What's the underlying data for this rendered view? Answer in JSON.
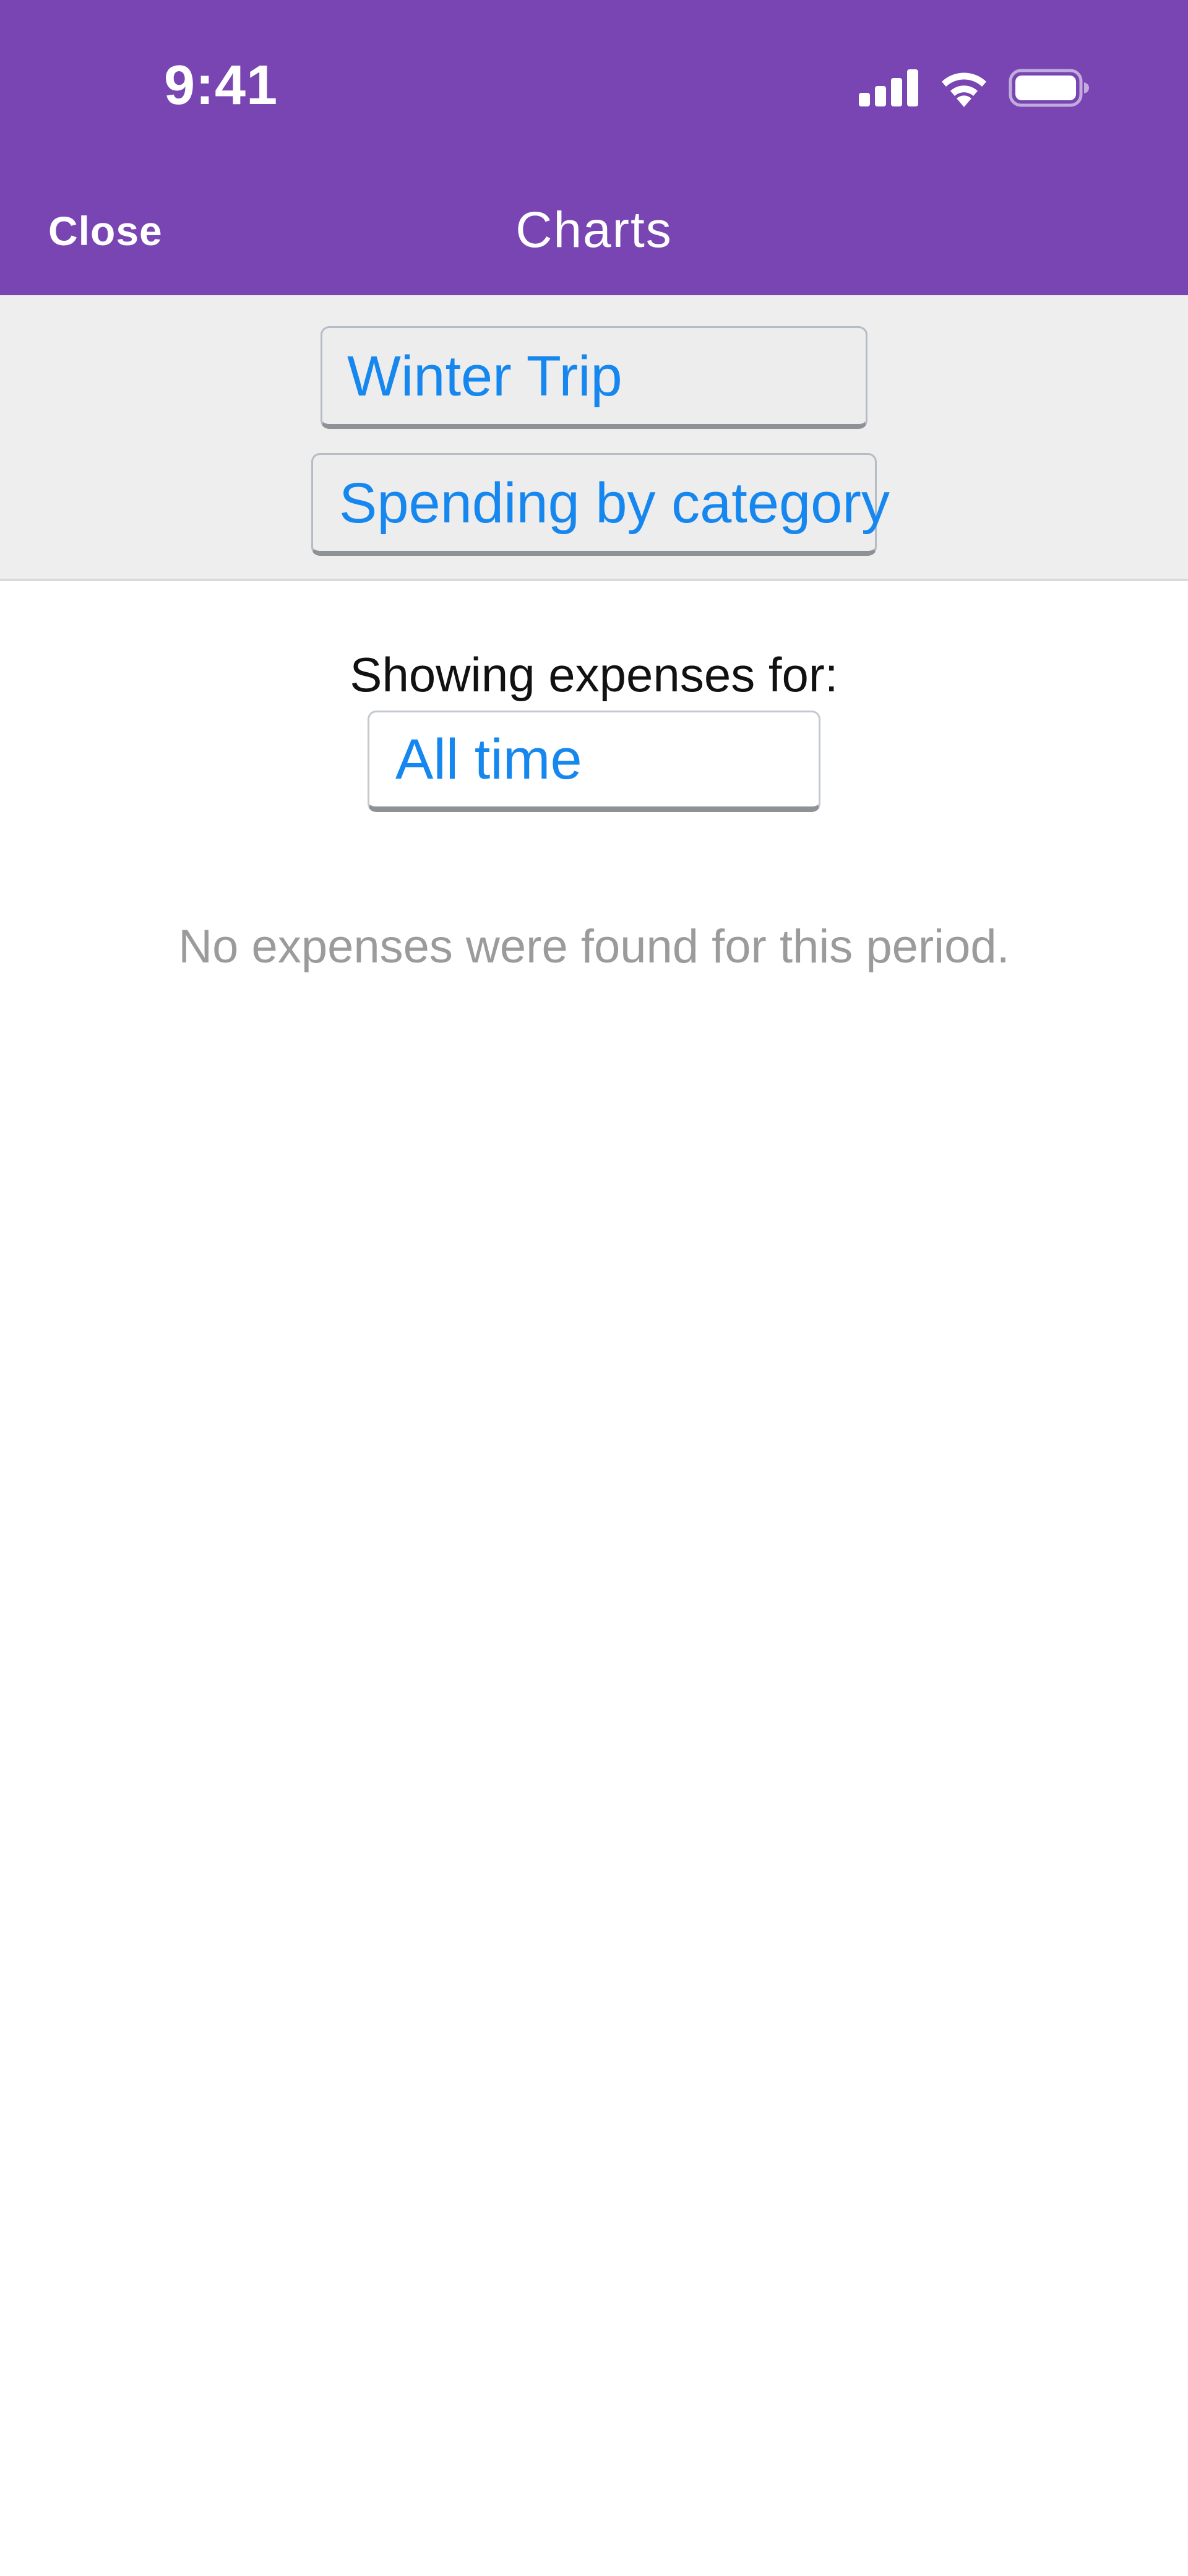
{
  "status_bar": {
    "time": "9:41",
    "icons": [
      "cellular-signal-icon",
      "wifi-icon",
      "battery-icon"
    ]
  },
  "nav_bar": {
    "close_label": "Close",
    "title": "Charts"
  },
  "selectors": {
    "trip": "Winter Trip",
    "chart_type": "Spending by category"
  },
  "content": {
    "period_label": "Showing expenses for:",
    "period_value": "All time",
    "empty_message": "No expenses were found for this period."
  },
  "colors": {
    "header_bg": "#7845b3",
    "accent": "#1687ee",
    "panel_bg": "#eeeeee",
    "muted_text": "#9b9b9b"
  }
}
